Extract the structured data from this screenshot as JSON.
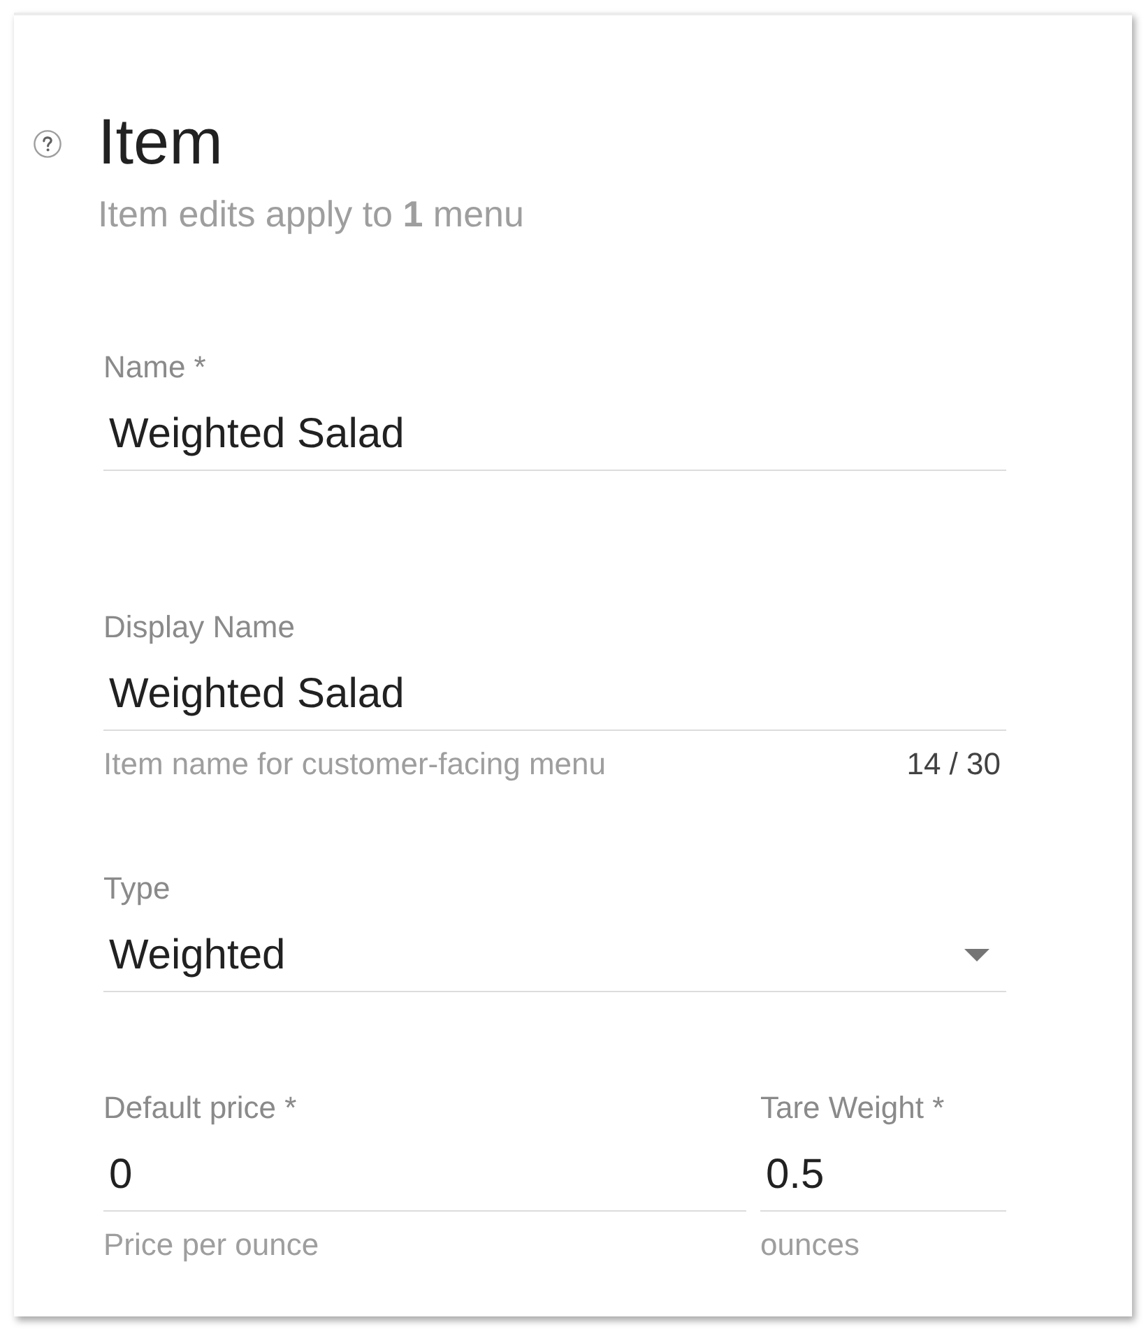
{
  "header": {
    "title": "Item",
    "subtitle": "Item edits apply to **1** menu"
  },
  "field_rows": [
    {
      "fields": [
        {
          "kind": "text",
          "label": "Name *",
          "value": "Weighted Salad"
        }
      ]
    },
    {
      "fields": [
        {
          "kind": "text",
          "label": "Display Name",
          "value": "Weighted Salad",
          "hint": "Item name for customer-facing menu",
          "counter": "14 / 30"
        }
      ]
    },
    {
      "fields": [
        {
          "kind": "select",
          "label": "Type",
          "value": "Weighted"
        }
      ]
    },
    {
      "fields": [
        {
          "kind": "text",
          "label": "Default price *",
          "value": "0",
          "hint": "Price per ounce"
        },
        {
          "kind": "text",
          "label": "Tare Weight *",
          "value": "0.5",
          "hint": "ounces"
        }
      ]
    }
  ]
}
